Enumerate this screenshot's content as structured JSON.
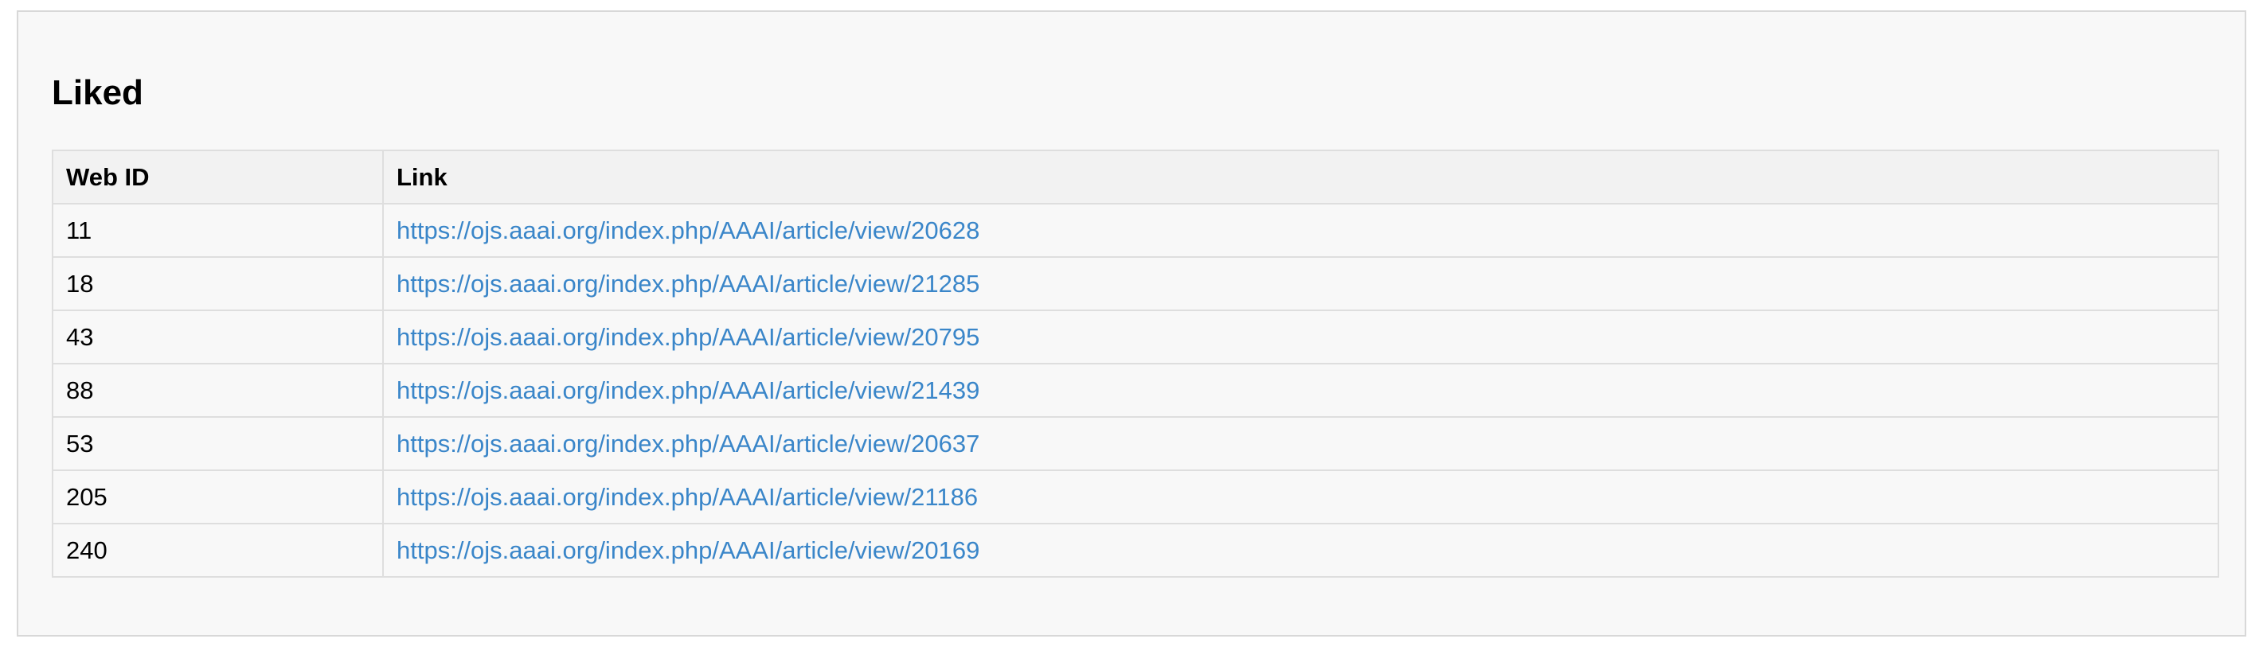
{
  "section": {
    "title": "Liked"
  },
  "table": {
    "headers": [
      "Web ID",
      "Link"
    ],
    "rows": [
      {
        "web_id": "11",
        "link": "https://ojs.aaai.org/index.php/AAAI/article/view/20628"
      },
      {
        "web_id": "18",
        "link": "https://ojs.aaai.org/index.php/AAAI/article/view/21285"
      },
      {
        "web_id": "43",
        "link": "https://ojs.aaai.org/index.php/AAAI/article/view/20795"
      },
      {
        "web_id": "88",
        "link": "https://ojs.aaai.org/index.php/AAAI/article/view/21439"
      },
      {
        "web_id": "53",
        "link": "https://ojs.aaai.org/index.php/AAAI/article/view/20637"
      },
      {
        "web_id": "205",
        "link": "https://ojs.aaai.org/index.php/AAAI/article/view/21186"
      },
      {
        "web_id": "240",
        "link": "https://ojs.aaai.org/index.php/AAAI/article/view/20169"
      }
    ]
  },
  "colors": {
    "link": "#3a86c9",
    "panel_bg": "#f8f8f8",
    "header_bg": "#f2f2f2",
    "border": "#dedede"
  }
}
